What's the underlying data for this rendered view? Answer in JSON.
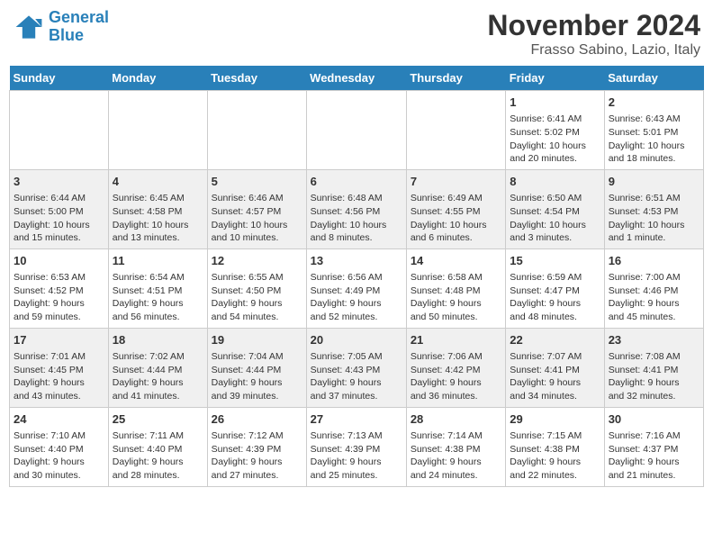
{
  "header": {
    "logo_line1": "General",
    "logo_line2": "Blue",
    "main_title": "November 2024",
    "sub_title": "Frasso Sabino, Lazio, Italy"
  },
  "days_of_week": [
    "Sunday",
    "Monday",
    "Tuesday",
    "Wednesday",
    "Thursday",
    "Friday",
    "Saturday"
  ],
  "weeks": [
    [
      {
        "day": "",
        "info": ""
      },
      {
        "day": "",
        "info": ""
      },
      {
        "day": "",
        "info": ""
      },
      {
        "day": "",
        "info": ""
      },
      {
        "day": "",
        "info": ""
      },
      {
        "day": "1",
        "info": "Sunrise: 6:41 AM\nSunset: 5:02 PM\nDaylight: 10 hours\nand 20 minutes."
      },
      {
        "day": "2",
        "info": "Sunrise: 6:43 AM\nSunset: 5:01 PM\nDaylight: 10 hours\nand 18 minutes."
      }
    ],
    [
      {
        "day": "3",
        "info": "Sunrise: 6:44 AM\nSunset: 5:00 PM\nDaylight: 10 hours\nand 15 minutes."
      },
      {
        "day": "4",
        "info": "Sunrise: 6:45 AM\nSunset: 4:58 PM\nDaylight: 10 hours\nand 13 minutes."
      },
      {
        "day": "5",
        "info": "Sunrise: 6:46 AM\nSunset: 4:57 PM\nDaylight: 10 hours\nand 10 minutes."
      },
      {
        "day": "6",
        "info": "Sunrise: 6:48 AM\nSunset: 4:56 PM\nDaylight: 10 hours\nand 8 minutes."
      },
      {
        "day": "7",
        "info": "Sunrise: 6:49 AM\nSunset: 4:55 PM\nDaylight: 10 hours\nand 6 minutes."
      },
      {
        "day": "8",
        "info": "Sunrise: 6:50 AM\nSunset: 4:54 PM\nDaylight: 10 hours\nand 3 minutes."
      },
      {
        "day": "9",
        "info": "Sunrise: 6:51 AM\nSunset: 4:53 PM\nDaylight: 10 hours\nand 1 minute."
      }
    ],
    [
      {
        "day": "10",
        "info": "Sunrise: 6:53 AM\nSunset: 4:52 PM\nDaylight: 9 hours\nand 59 minutes."
      },
      {
        "day": "11",
        "info": "Sunrise: 6:54 AM\nSunset: 4:51 PM\nDaylight: 9 hours\nand 56 minutes."
      },
      {
        "day": "12",
        "info": "Sunrise: 6:55 AM\nSunset: 4:50 PM\nDaylight: 9 hours\nand 54 minutes."
      },
      {
        "day": "13",
        "info": "Sunrise: 6:56 AM\nSunset: 4:49 PM\nDaylight: 9 hours\nand 52 minutes."
      },
      {
        "day": "14",
        "info": "Sunrise: 6:58 AM\nSunset: 4:48 PM\nDaylight: 9 hours\nand 50 minutes."
      },
      {
        "day": "15",
        "info": "Sunrise: 6:59 AM\nSunset: 4:47 PM\nDaylight: 9 hours\nand 48 minutes."
      },
      {
        "day": "16",
        "info": "Sunrise: 7:00 AM\nSunset: 4:46 PM\nDaylight: 9 hours\nand 45 minutes."
      }
    ],
    [
      {
        "day": "17",
        "info": "Sunrise: 7:01 AM\nSunset: 4:45 PM\nDaylight: 9 hours\nand 43 minutes."
      },
      {
        "day": "18",
        "info": "Sunrise: 7:02 AM\nSunset: 4:44 PM\nDaylight: 9 hours\nand 41 minutes."
      },
      {
        "day": "19",
        "info": "Sunrise: 7:04 AM\nSunset: 4:44 PM\nDaylight: 9 hours\nand 39 minutes."
      },
      {
        "day": "20",
        "info": "Sunrise: 7:05 AM\nSunset: 4:43 PM\nDaylight: 9 hours\nand 37 minutes."
      },
      {
        "day": "21",
        "info": "Sunrise: 7:06 AM\nSunset: 4:42 PM\nDaylight: 9 hours\nand 36 minutes."
      },
      {
        "day": "22",
        "info": "Sunrise: 7:07 AM\nSunset: 4:41 PM\nDaylight: 9 hours\nand 34 minutes."
      },
      {
        "day": "23",
        "info": "Sunrise: 7:08 AM\nSunset: 4:41 PM\nDaylight: 9 hours\nand 32 minutes."
      }
    ],
    [
      {
        "day": "24",
        "info": "Sunrise: 7:10 AM\nSunset: 4:40 PM\nDaylight: 9 hours\nand 30 minutes."
      },
      {
        "day": "25",
        "info": "Sunrise: 7:11 AM\nSunset: 4:40 PM\nDaylight: 9 hours\nand 28 minutes."
      },
      {
        "day": "26",
        "info": "Sunrise: 7:12 AM\nSunset: 4:39 PM\nDaylight: 9 hours\nand 27 minutes."
      },
      {
        "day": "27",
        "info": "Sunrise: 7:13 AM\nSunset: 4:39 PM\nDaylight: 9 hours\nand 25 minutes."
      },
      {
        "day": "28",
        "info": "Sunrise: 7:14 AM\nSunset: 4:38 PM\nDaylight: 9 hours\nand 24 minutes."
      },
      {
        "day": "29",
        "info": "Sunrise: 7:15 AM\nSunset: 4:38 PM\nDaylight: 9 hours\nand 22 minutes."
      },
      {
        "day": "30",
        "info": "Sunrise: 7:16 AM\nSunset: 4:37 PM\nDaylight: 9 hours\nand 21 minutes."
      }
    ]
  ]
}
